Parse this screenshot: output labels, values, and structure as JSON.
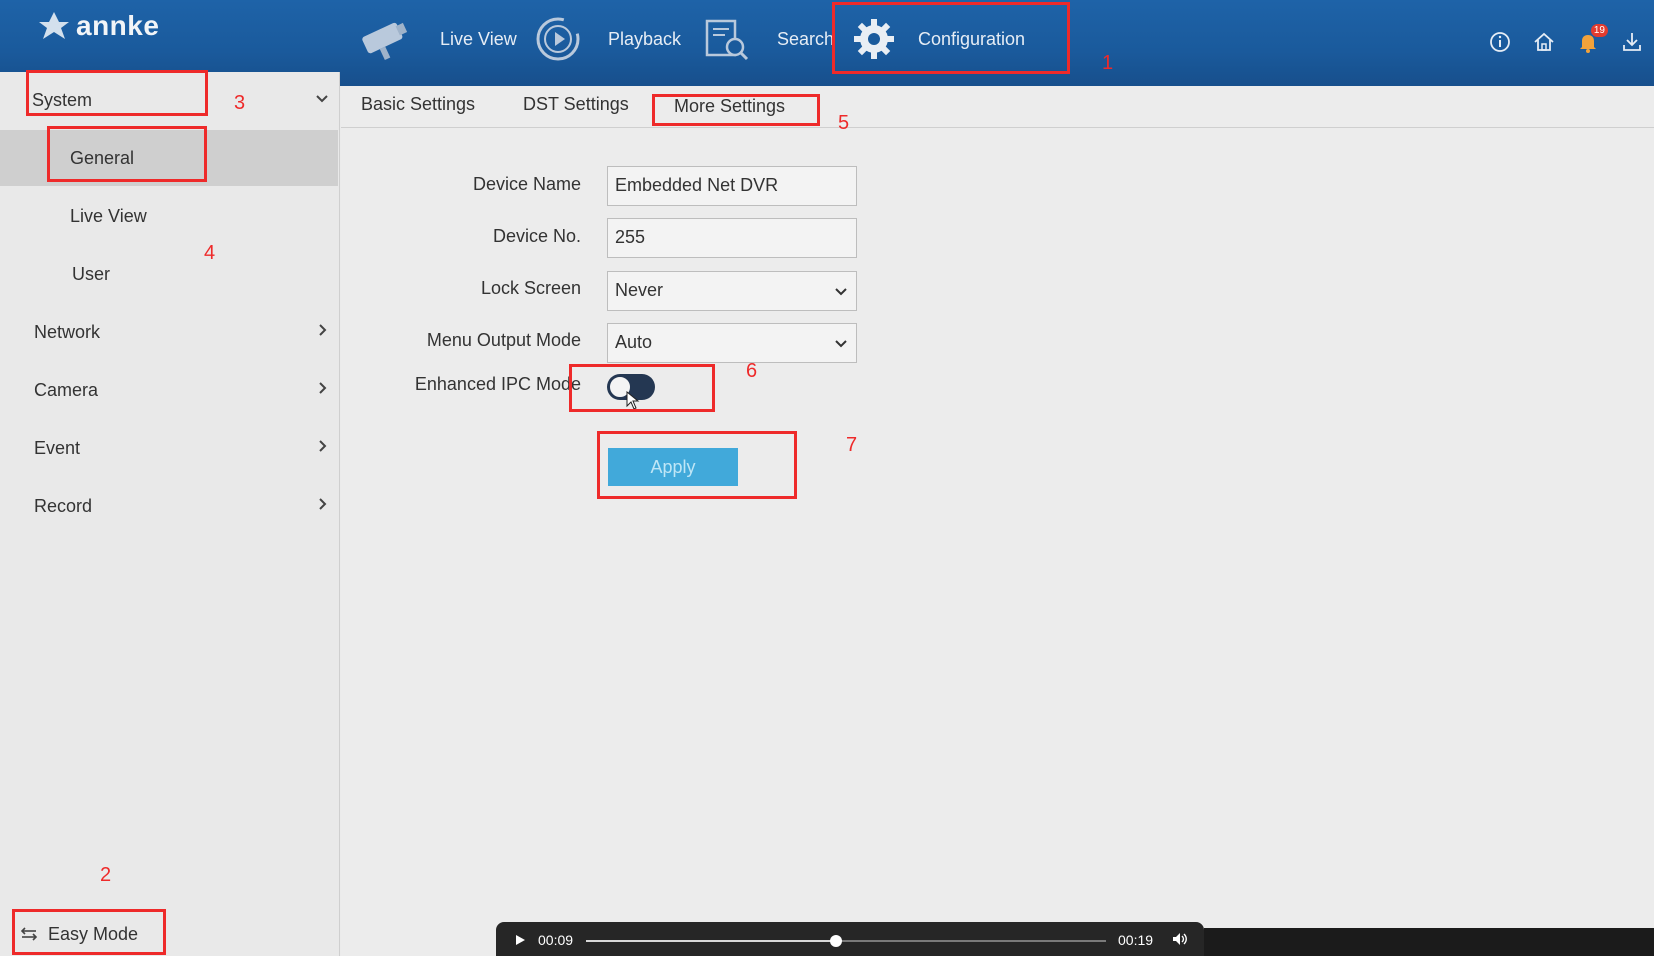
{
  "brand": {
    "logo_text": "annke"
  },
  "topnav": {
    "items": [
      {
        "label": "Live View",
        "icon": "camera-icon"
      },
      {
        "label": "Playback",
        "icon": "playback-icon"
      },
      {
        "label": "Search",
        "icon": "search-icon"
      },
      {
        "label": "Configuration",
        "icon": "gear-icon"
      }
    ],
    "right_icons": [
      "info-icon",
      "home-icon",
      "bell-icon",
      "download-icon"
    ],
    "notification_count": "19"
  },
  "sidebar": {
    "items": [
      {
        "label": "System",
        "expanded": true
      },
      {
        "label": "General",
        "active": true
      },
      {
        "label": "Live View"
      },
      {
        "label": "User"
      },
      {
        "label": "Network"
      },
      {
        "label": "Camera"
      },
      {
        "label": "Event"
      },
      {
        "label": "Record"
      }
    ],
    "easy_mode": "Easy Mode"
  },
  "tabs": [
    "Basic Settings",
    "DST Settings",
    "More Settings"
  ],
  "form": {
    "device_name": {
      "label": "Device Name",
      "value": "Embedded Net DVR"
    },
    "device_no": {
      "label": "Device No.",
      "value": "255"
    },
    "lock_screen": {
      "label": "Lock Screen",
      "value": "Never"
    },
    "menu_output_mode": {
      "label": "Menu Output Mode",
      "value": "Auto"
    },
    "enhanced_ipc_mode": {
      "label": "Enhanced IPC Mode",
      "enabled": false
    },
    "apply_label": "Apply"
  },
  "annotations": [
    "1",
    "2",
    "3",
    "4",
    "5",
    "6",
    "7"
  ],
  "player": {
    "current": "00:09",
    "total": "00:19",
    "progress": 0.48
  },
  "colors": {
    "topbar": "#1a5a9c",
    "annotation": "#ee2a2a",
    "apply": "#41a9da"
  }
}
